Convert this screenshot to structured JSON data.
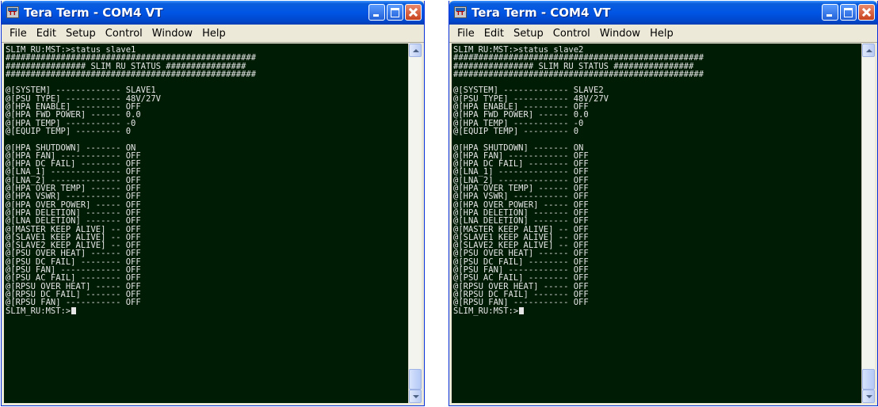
{
  "windows": [
    {
      "title": "Tera Term - COM4 VT",
      "menu": [
        "File",
        "Edit",
        "Setup",
        "Control",
        "Window",
        "Help"
      ],
      "lines": [
        "SLIM_RU:MST:>status slave1",
        "##################################################",
        "################ SLIM RU STATUS ################",
        "##################################################",
        "",
        "@[SYSTEM] ------------- SLAVE1",
        "@[PSU TYPE] ----------- 48V/27V",
        "@[HPA ENABLE] --------- OFF",
        "@[HPA FWD POWER] ------ 0.0",
        "@[HPA TEMP] ----------- -0",
        "@[EQUIP TEMP] --------- 0",
        "",
        "@[HPA SHUTDOWN] ------- ON",
        "@[HPA FAN] ------------ OFF",
        "@[HPA DC FAIL] -------- OFF",
        "@[LNA_1] -------------- OFF",
        "@[LNA_2] -------------- OFF",
        "@[HPA OVER TEMP] ------ OFF",
        "@[HPA VSWR] ----------- OFF",
        "@[HPA OVER POWER] ----- OFF",
        "@[HPA DELETION] ------- OFF",
        "@[LNA DELETION] ------- OFF",
        "@[MASTER KEEP ALIVE] -- OFF",
        "@[SLAVE1 KEEP ALIVE] -- OFF",
        "@[SLAVE2 KEEP ALIVE] -- OFF",
        "@[PSU OVER HEAT] ------ OFF",
        "@[PSU DC FAIL] -------- OFF",
        "@[PSU FAN] ------------ OFF",
        "@[PSU AC FAIL] -------- OFF",
        "@[RPSU OVER HEAT] ----- OFF",
        "@[RPSU DC FAIL] ------- OFF",
        "@[RPSU FAN] ----------- OFF"
      ],
      "prompt": "SLIM_RU:MST:>"
    },
    {
      "title": "Tera Term - COM4 VT",
      "menu": [
        "File",
        "Edit",
        "Setup",
        "Control",
        "Window",
        "Help"
      ],
      "lines": [
        "SLIM_RU:MST:>status slave2",
        "##################################################",
        "################ SLIM RU STATUS ################",
        "##################################################",
        "",
        "@[SYSTEM] ------------- SLAVE2",
        "@[PSU TYPE] ----------- 48V/27V",
        "@[HPA ENABLE] --------- OFF",
        "@[HPA FWD POWER] ------ 0.0",
        "@[HPA TEMP] ----------- -0",
        "@[EQUIP TEMP] --------- 0",
        "",
        "@[HPA SHUTDOWN] ------- ON",
        "@[HPA FAN] ------------ OFF",
        "@[HPA DC FAIL] -------- OFF",
        "@[LNA_1] -------------- OFF",
        "@[LNA_2] -------------- OFF",
        "@[HPA OVER TEMP] ------ OFF",
        "@[HPA VSWR] ----------- OFF",
        "@[HPA OVER POWER] ----- OFF",
        "@[HPA DELETION] ------- OFF",
        "@[LNA DELETION] ------- OFF",
        "@[MASTER KEEP ALIVE] -- OFF",
        "@[SLAVE1 KEEP ALIVE] -- OFF",
        "@[SLAVE2 KEEP ALIVE] -- OFF",
        "@[PSU OVER HEAT] ------ OFF",
        "@[PSU DC FAIL] -------- OFF",
        "@[PSU FAN] ------------ OFF",
        "@[PSU AC FAIL] -------- OFF",
        "@[RPSU OVER HEAT] ----- OFF",
        "@[RPSU DC FAIL] ------- OFF",
        "@[RPSU FAN] ----------- OFF"
      ],
      "prompt": "SLIM_RU:MST:>"
    }
  ]
}
